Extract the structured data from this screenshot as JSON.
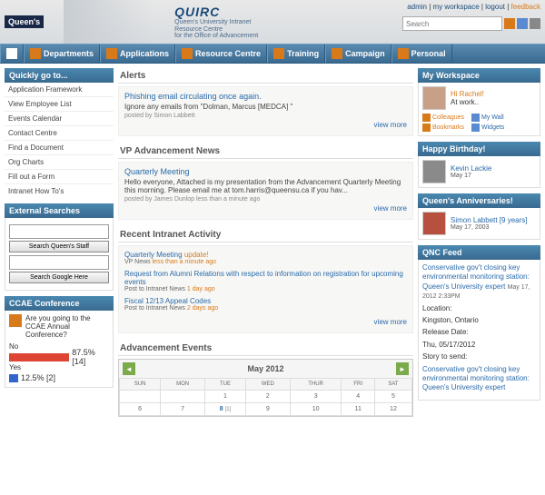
{
  "header": {
    "logo": "Queen's",
    "title": "QUIRC",
    "subtitle1": "Queen's University Intranet",
    "subtitle2": "Resource Centre",
    "subtitle3": "for the Office of Advancement",
    "top_links": {
      "admin": "admin",
      "workspace": "my workspace",
      "logout": "logout",
      "feedback": "feedback"
    },
    "search_placeholder": "Search"
  },
  "nav": [
    {
      "label": ""
    },
    {
      "label": "Departments"
    },
    {
      "label": "Applications"
    },
    {
      "label": "Resource Centre"
    },
    {
      "label": "Training"
    },
    {
      "label": "Campaign"
    },
    {
      "label": "Personal"
    }
  ],
  "quicklinks": {
    "title": "Quickly go to...",
    "items": [
      "Application Framework",
      "View Employee List",
      "Events Calendar",
      "Contact Centre",
      "Find a Document",
      "Org Charts",
      "Fill out a Form",
      "Intranet How To's"
    ]
  },
  "ext_search": {
    "title": "External Searches",
    "btn1": "Search Queen's Staff",
    "btn2": "Search Google Here"
  },
  "poll": {
    "title": "CCAE Conference",
    "question": "Are you going to the CCAE Annual Conference?",
    "opts": [
      {
        "label": "No",
        "pct": "87.5% [14]",
        "w": 70,
        "cls": "pb-red"
      },
      {
        "label": "Yes",
        "pct": "12.5% [2]",
        "w": 10,
        "cls": "pb-blue"
      }
    ]
  },
  "alerts": {
    "hdr": "Alerts",
    "title": "Phishing email circulating once again.",
    "body": "Ignore any emails from \"Dolman, Marcus [MEDCA] \"",
    "meta": "posted by Simon Labbett",
    "more": "view more"
  },
  "vpnews": {
    "hdr": "VP Advancement News",
    "title": "Quarterly Meeting",
    "body": "Hello everyone, Attached is my presentation from the Advancement Quarterly Meeting this morning. Please email me at tom.harris@queensu.ca if you hav...",
    "meta": "posted by James Dunlop less than a minute ago",
    "more": "view more"
  },
  "activity": {
    "hdr": "Recent Intranet Activity",
    "items": [
      {
        "title": "Quarterly Meeting",
        "tag": "update!",
        "sub": "VP News",
        "when": "less than a minute ago"
      },
      {
        "title": "Request from Alumni Relations with respect to information on registration for upcoming events",
        "tag": "",
        "sub": "Post to Intranet News",
        "when": "1 day ago"
      },
      {
        "title": "Fiscal 12/13 Appeal Codes",
        "tag": "",
        "sub": "Post to Intranet News",
        "when": "2 days ago"
      }
    ],
    "more": "view more"
  },
  "events_hdr": "Advancement Events",
  "cal": {
    "month": "May 2012",
    "days": [
      "SUN",
      "MON",
      "TUE",
      "WED",
      "THUR",
      "FRI",
      "SAT"
    ],
    "rows": [
      [
        "",
        "",
        "1",
        "2",
        "3",
        "4",
        "5"
      ],
      [
        "6",
        "7",
        "8",
        "9",
        "10",
        "11",
        "12"
      ]
    ],
    "today": "8",
    "today_ev": "[1]"
  },
  "workspace": {
    "title": "My Workspace",
    "greeting": "Hi Rachel!",
    "status": "At work..",
    "links": {
      "colleagues": "Colleagues",
      "wall": "My Wall",
      "bookmarks": "Bookmarks",
      "widgets": "Widgets"
    }
  },
  "birthday": {
    "title": "Happy Birthday!",
    "name": "Kevin Lackie",
    "date": "May 17"
  },
  "anniv": {
    "title": "Queen's Anniversaries!",
    "name": "Simon Labbett [9 years]",
    "date": "May 17, 2003"
  },
  "qnc": {
    "title": "QNC Feed",
    "item1_link": "Conservative gov't closing key environmental monitoring station: Queen's University expert",
    "item1_date": "May 17, 2012 2:33PM",
    "loc_lbl": "Location:",
    "loc": "Kingston, Ontario",
    "rel_lbl": "Release Date:",
    "rel": "Thu, 05/17/2012",
    "story_lbl": "Story to send:",
    "item2_link": "Conservative gov't closing key environmental monitoring station: Queen's University expert"
  }
}
